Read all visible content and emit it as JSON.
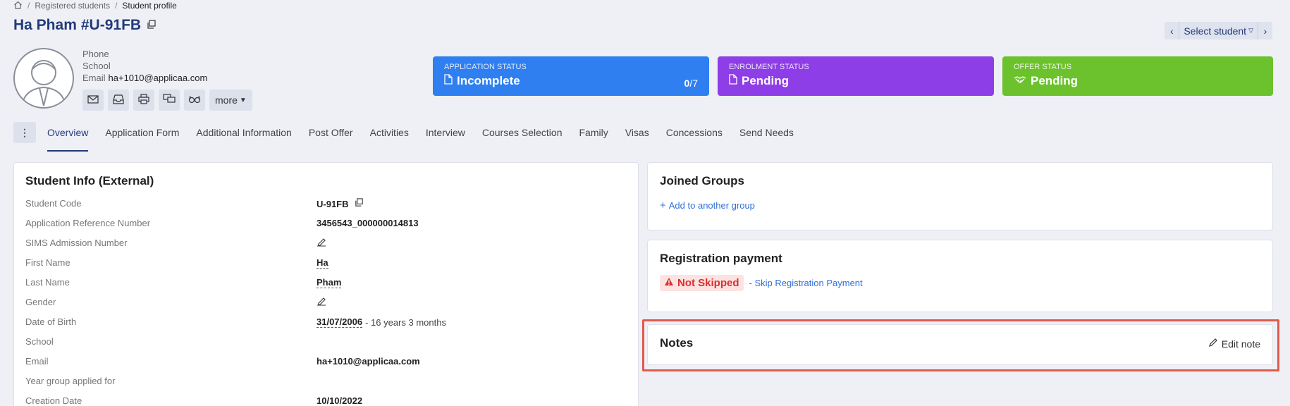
{
  "breadcrumb": {
    "items": [
      "Registered students",
      "Student profile"
    ]
  },
  "student": {
    "name": "Ha Pham",
    "id": "#U-91FB"
  },
  "contact": {
    "phone_label": "Phone",
    "school_label": "School",
    "email_label": "Email",
    "email_value": "ha+1010@applicaa.com"
  },
  "actions": {
    "more_label": "more"
  },
  "navigator": {
    "select_label": "Select student"
  },
  "status": {
    "application": {
      "label": "APPLICATION STATUS",
      "value": "Incomplete",
      "count_done": "0",
      "count_total": "/7",
      "color": "#2f7ff0"
    },
    "enrolment": {
      "label": "ENROLMENT STATUS",
      "value": "Pending",
      "color": "#8e3ee6"
    },
    "offer": {
      "label": "OFFER STATUS",
      "value": "Pending",
      "color": "#6cc22d"
    }
  },
  "tabs": [
    "Overview",
    "Application Form",
    "Additional Information",
    "Post Offer",
    "Activities",
    "Interview",
    "Courses Selection",
    "Family",
    "Visas",
    "Concessions",
    "Send Needs"
  ],
  "info": {
    "title": "Student Info (External)",
    "rows": [
      {
        "label": "Student Code",
        "value": "U-91FB"
      },
      {
        "label": "Application Reference Number",
        "value": "3456543_000000014813"
      },
      {
        "label": "SIMS Admission Number",
        "value": ""
      },
      {
        "label": "First Name",
        "value": "Ha"
      },
      {
        "label": "Last Name",
        "value": "Pham"
      },
      {
        "label": "Gender",
        "value": ""
      },
      {
        "label": "Date of Birth",
        "value": "31/07/2006",
        "extra": "- 16 years 3 months"
      },
      {
        "label": "School",
        "value": ""
      },
      {
        "label": "Email",
        "value": "ha+1010@applicaa.com"
      },
      {
        "label": "Year group applied for",
        "value": ""
      },
      {
        "label": "Creation Date",
        "value": "10/10/2022"
      }
    ]
  },
  "groups": {
    "title": "Joined Groups",
    "add_link": "Add to another group"
  },
  "payment": {
    "title": "Registration payment",
    "badge": "Not Skipped",
    "skip_link": "- Skip Registration Payment"
  },
  "notes": {
    "title": "Notes",
    "edit_label": "Edit note"
  }
}
